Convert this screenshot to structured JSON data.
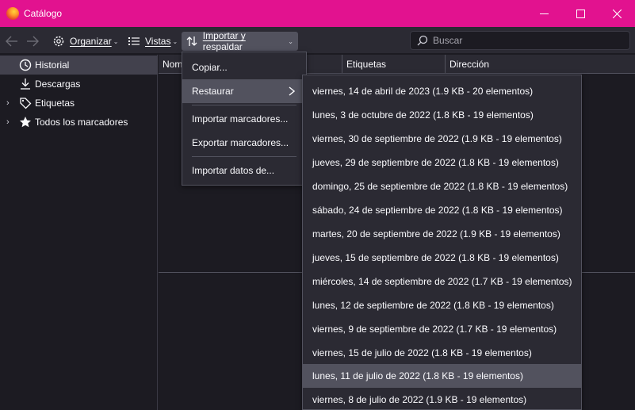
{
  "window": {
    "title": "Catálogo"
  },
  "toolbar": {
    "organize_label": "Organizar",
    "views_label": "Vistas",
    "import_label": "Importar y respaldar",
    "search_placeholder": "Buscar"
  },
  "sidebar": {
    "items": [
      {
        "label": "Historial",
        "icon": "clock-icon"
      },
      {
        "label": "Descargas",
        "icon": "download-icon"
      },
      {
        "label": "Etiquetas",
        "icon": "tag-icon"
      },
      {
        "label": "Todos los marcadores",
        "icon": "star-icon"
      }
    ]
  },
  "columns": [
    "Nombre",
    "Etiquetas",
    "Dirección"
  ],
  "menu": {
    "items": [
      "Copiar...",
      "Restaurar",
      "Importar marcadores...",
      "Exportar marcadores...",
      "Importar datos de..."
    ]
  },
  "submenu": {
    "items": [
      "viernes, 14 de abril de 2023 (1.9 KB - 20 elementos)",
      "lunes, 3 de octubre de 2022 (1.8 KB - 19 elementos)",
      "viernes, 30 de septiembre de 2022 (1.9 KB - 19 elementos)",
      "jueves, 29 de septiembre de 2022 (1.8 KB - 19 elementos)",
      "domingo, 25 de septiembre de 2022 (1.8 KB - 19 elementos)",
      "sábado, 24 de septiembre de 2022 (1.8 KB - 19 elementos)",
      "martes, 20 de septiembre de 2022 (1.9 KB - 19 elementos)",
      "jueves, 15 de septiembre de 2022 (1.8 KB - 19 elementos)",
      "miércoles, 14 de septiembre de 2022 (1.7 KB - 19 elementos)",
      "lunes, 12 de septiembre de 2022 (1.8 KB - 19 elementos)",
      "viernes, 9 de septiembre de 2022 (1.7 KB - 19 elementos)",
      "viernes, 15 de julio de 2022 (1.8 KB - 19 elementos)",
      "lunes, 11 de julio de 2022 (1.8 KB - 19 elementos)",
      "viernes, 8 de julio de 2022 (1.9 KB - 19 elementos)"
    ]
  },
  "colors": {
    "titlebar": "#e2128f",
    "toolbar": "#2b2a33",
    "background": "#1c1b22",
    "highlight": "#52525e"
  }
}
